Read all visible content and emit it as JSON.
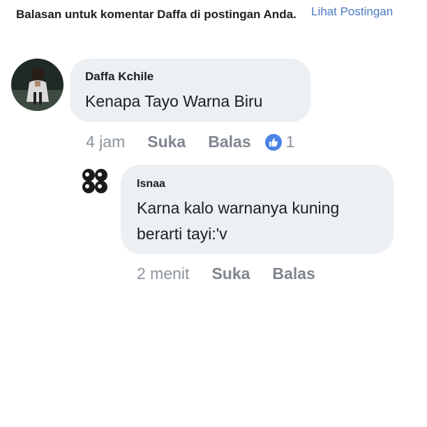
{
  "header": {
    "title": "Balasan untuk komentar Daffa di postingan Anda.",
    "link_label": "Lihat Postingan"
  },
  "comment": {
    "author": "Daffa Kchile",
    "text": "Kenapa Tayo Warna Biru",
    "time": "4 jam",
    "like_label": "Suka",
    "reply_label": "Balas",
    "reaction_icon": "thumbs-up-icon",
    "reaction_count": "1"
  },
  "reply": {
    "author": "Isnaa",
    "text": "Karna kalo warnanya kuning berarti tayi:'v",
    "time": "2 menit",
    "like_label": "Suka",
    "reply_label": "Balas"
  },
  "colors": {
    "link": "#4a78c4",
    "bubble": "#edf0f3",
    "like_badge": "#4b83e6",
    "muted": "#8d949e"
  }
}
